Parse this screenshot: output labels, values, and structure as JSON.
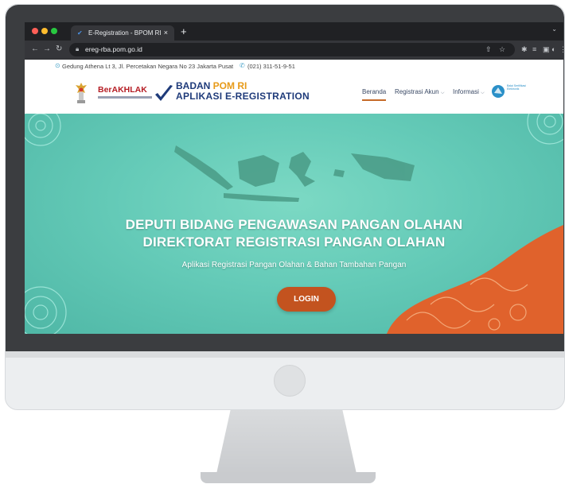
{
  "browser": {
    "tab_title": "E-Registration - BPOM RI",
    "tab_close": "×",
    "new_tab": "+",
    "url": "ereg-rba.pom.go.id"
  },
  "site": {
    "address": "Gedung Athena Lt 3, Jl. Percetakan Negara No 23 Jakarta Pusat",
    "phone": "(021) 311-51-9-51",
    "berakhlak": "BerAKHLAK",
    "brand_line1_prefix": "BADAN ",
    "brand_line1_accent": "POM RI",
    "brand_line2": "APLIKASI E-REGISTRATION",
    "menu": {
      "home": "Beranda",
      "register": "Registrasi Akun",
      "info": "Informasi"
    },
    "bse_text": "Balai Sertifikasi Elektronik"
  },
  "hero": {
    "title_line1": "DEPUTI BIDANG PENGAWASAN PANGAN OLAHAN",
    "title_line2": "DIREKTORAT REGISTRASI PANGAN OLAHAN",
    "subtitle": "Aplikasi Registrasi Pangan Olahan & Bahan Tambahan Pangan",
    "login_label": "LOGIN"
  },
  "colors": {
    "hero_teal": "#65cbb8",
    "login_orange": "#c3531f",
    "brand_navy": "#1f3b7a",
    "brand_accent": "#e79a18",
    "berakhlak_red": "#b51d24"
  }
}
